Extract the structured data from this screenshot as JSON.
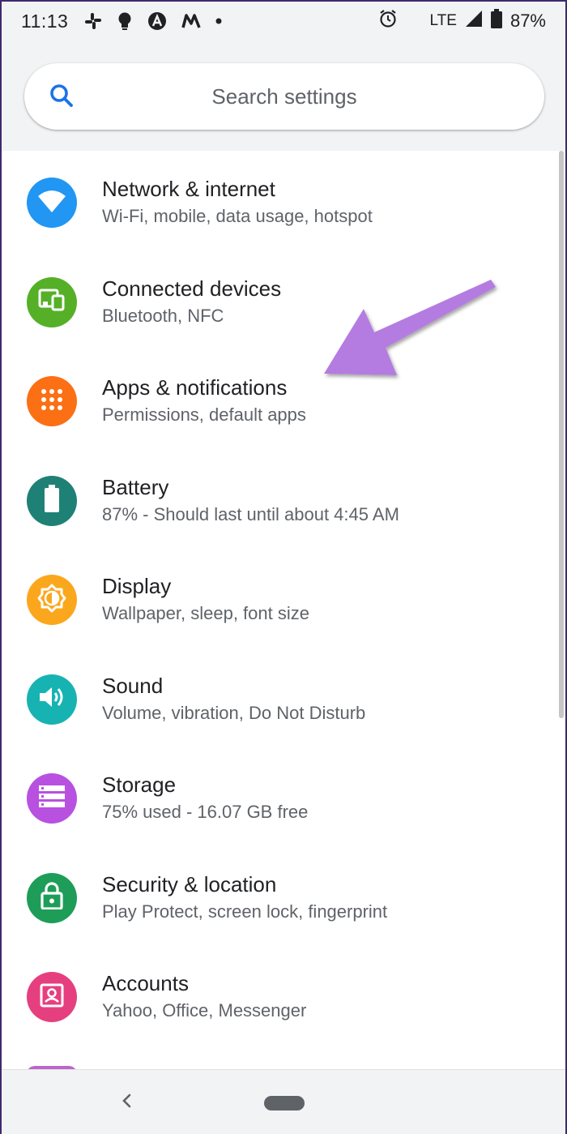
{
  "status_bar": {
    "time": "11:13",
    "network": "LTE",
    "battery": "87%"
  },
  "search": {
    "placeholder": "Search settings"
  },
  "items": [
    {
      "title": "Network & internet",
      "subtitle": "Wi-Fi, mobile, data usage, hotspot",
      "color": "#2196f3",
      "icon": "wifi-icon"
    },
    {
      "title": "Connected devices",
      "subtitle": "Bluetooth, NFC",
      "color": "#55b027",
      "icon": "devices-icon"
    },
    {
      "title": "Apps & notifications",
      "subtitle": "Permissions, default apps",
      "color": "#fb7014",
      "icon": "apps-grid-icon"
    },
    {
      "title": "Battery",
      "subtitle": "87% - Should last until about 4:45 AM",
      "color": "#1f8176",
      "icon": "battery-icon"
    },
    {
      "title": "Display",
      "subtitle": "Wallpaper, sleep, font size",
      "color": "#fba71d",
      "icon": "brightness-icon"
    },
    {
      "title": "Sound",
      "subtitle": "Volume, vibration, Do Not Disturb",
      "color": "#17b3b2",
      "icon": "volume-icon"
    },
    {
      "title": "Storage",
      "subtitle": "75% used - 16.07 GB free",
      "color": "#b851e0",
      "icon": "storage-icon"
    },
    {
      "title": "Security & location",
      "subtitle": "Play Protect, screen lock, fingerprint",
      "color": "#1e9d58",
      "icon": "lock-icon"
    },
    {
      "title": "Accounts",
      "subtitle": "Yahoo, Office, Messenger",
      "color": "#e63f7f",
      "icon": "account-icon"
    }
  ],
  "annotation": {
    "arrow_color": "#b47be0"
  }
}
